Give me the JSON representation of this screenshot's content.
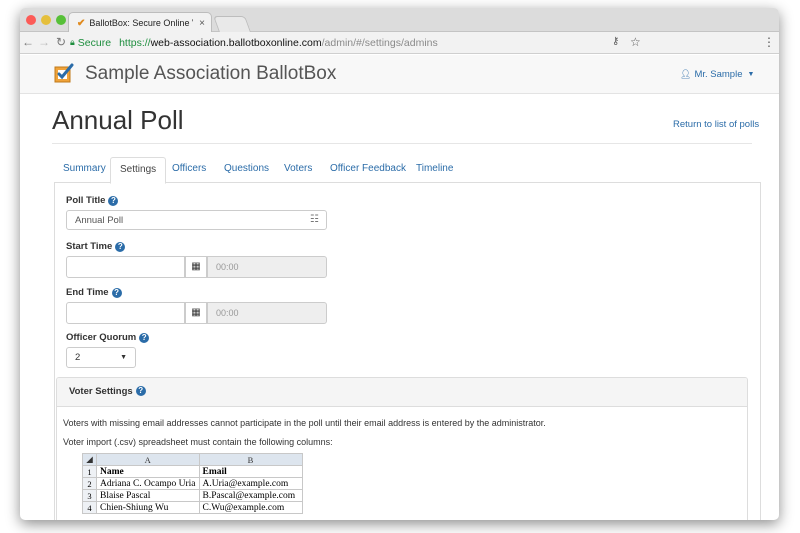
{
  "browser": {
    "tab_title": "BallotBox: Secure Online Votin",
    "tab_close": "×",
    "secure_label": "Secure",
    "url_scheme": "https://",
    "url_host": "web-association.ballotboxonline.com",
    "url_path": "/admin/#/settings/admins"
  },
  "header": {
    "brand": "Sample Association BallotBox",
    "user": "Mr. Sample"
  },
  "page": {
    "title": "Annual Poll",
    "return_link": "Return to list of polls"
  },
  "tabs": [
    {
      "label": "Summary"
    },
    {
      "label": "Settings"
    },
    {
      "label": "Officers"
    },
    {
      "label": "Questions"
    },
    {
      "label": "Voters"
    },
    {
      "label": "Officer Feedback"
    },
    {
      "label": "Timeline"
    }
  ],
  "form": {
    "poll_title_label": "Poll Title",
    "poll_title_value": "Annual Poll",
    "start_time_label": "Start Time",
    "start_time_value": "00:00",
    "end_time_label": "End Time",
    "end_time_value": "00:00",
    "quorum_label": "Officer Quorum",
    "quorum_value": "2"
  },
  "voter_settings": {
    "heading": "Voter Settings",
    "note": "Voters with missing email addresses cannot participate in the poll until their email address is entered by the administrator.",
    "import_note": "Voter import (.csv) spreadsheet must contain the following columns:",
    "sheet": {
      "col_headers": [
        "A",
        "B"
      ],
      "rows": [
        {
          "num": "1",
          "a": "Name",
          "b": "Email"
        },
        {
          "num": "2",
          "a": "Adriana C. Ocampo Uria",
          "b": "A.Uria@example.com"
        },
        {
          "num": "3",
          "a": "Blaise Pascal",
          "b": "B.Pascal@example.com"
        },
        {
          "num": "4",
          "a": "Chien-Shiung Wu",
          "b": "C.Wu@example.com"
        }
      ]
    }
  },
  "colors": {
    "link": "#2b6ca8",
    "secure_green": "#1e8e3e"
  }
}
